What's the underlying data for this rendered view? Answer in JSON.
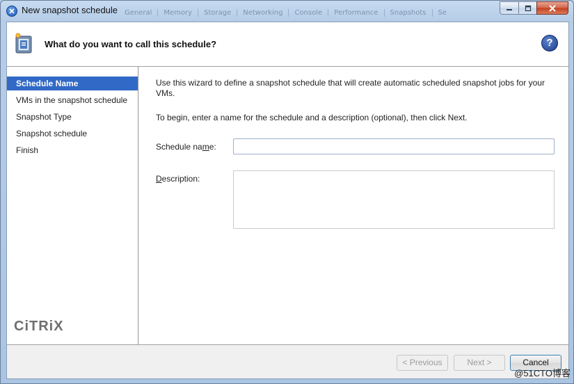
{
  "window": {
    "title": "New snapshot schedule",
    "background_tabs": [
      "General",
      "Memory",
      "Storage",
      "Networking",
      "Console",
      "Performance",
      "Snapshots",
      "Search"
    ]
  },
  "header": {
    "title": "What do you want to call this schedule?",
    "help_label": "?"
  },
  "sidebar": {
    "items": [
      {
        "label": "Schedule Name",
        "active": true
      },
      {
        "label": "VMs in the snapshot schedule",
        "active": false
      },
      {
        "label": "Snapshot Type",
        "active": false
      },
      {
        "label": "Snapshot schedule",
        "active": false
      },
      {
        "label": "Finish",
        "active": false
      }
    ],
    "logo": "CiTRiX"
  },
  "main": {
    "intro": "Use this wizard to define a snapshot schedule that will create automatic scheduled snapshot jobs for your VMs.",
    "instruction": "To begin, enter a name for the schedule and a description (optional), then click Next.",
    "schedule_name_label_pre": "Schedule na",
    "schedule_name_label_key": "m",
    "schedule_name_label_post": "e:",
    "schedule_name_value": "",
    "description_label_key": "D",
    "description_label_post": "escription:",
    "description_value": ""
  },
  "footer": {
    "previous": "< Previous",
    "next": "Next >",
    "cancel": "Cancel"
  },
  "watermark": "@51CTO博客",
  "colors": {
    "accent": "#3169c6",
    "close_button": "#c3401f"
  }
}
